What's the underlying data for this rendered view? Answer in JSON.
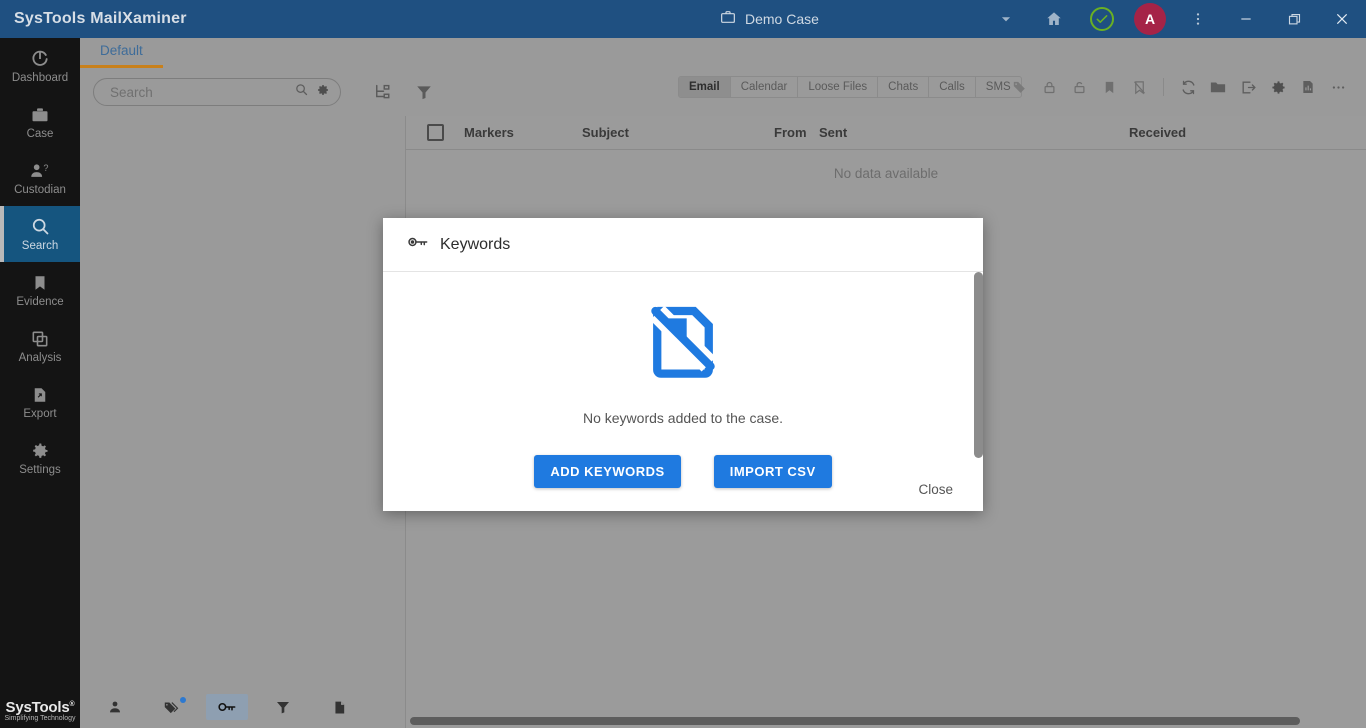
{
  "titlebar": {
    "app_title": "SysTools MailXaminer",
    "case_icon": "briefcase-icon",
    "case_name": "Demo Case",
    "dropdown_icon": "chevron-down-icon",
    "home_icon": "home-icon",
    "status_icon": "check-circle-icon",
    "avatar_letter": "A",
    "more_icon": "more-vertical-icon",
    "minimize_icon": "minimize-icon",
    "restore_icon": "restore-icon",
    "close_icon": "close-icon",
    "bg_color": "#1f5081",
    "avatar_color": "#a52347",
    "status_color": "#6ab023"
  },
  "sidebar": {
    "items": [
      {
        "label": "Dashboard",
        "icon": "dashboard-icon",
        "active": false
      },
      {
        "label": "Case",
        "icon": "briefcase-icon",
        "active": false
      },
      {
        "label": "Custodian",
        "icon": "custodian-icon",
        "active": false
      },
      {
        "label": "Search",
        "icon": "search-icon",
        "active": true
      },
      {
        "label": "Evidence",
        "icon": "evidence-icon",
        "active": false
      },
      {
        "label": "Analysis",
        "icon": "analysis-icon",
        "active": false
      },
      {
        "label": "Export",
        "icon": "export-icon",
        "active": false
      },
      {
        "label": "Settings",
        "icon": "gear-icon",
        "active": false
      }
    ],
    "active_color": "#15557f",
    "logo_name": "SysTools",
    "logo_reg": "®",
    "logo_tagline": "Simplifying Technology"
  },
  "tabs": {
    "document_tab": "Default",
    "underline_color": "#c8801b"
  },
  "toolbar": {
    "search_placeholder": "Search",
    "search_value": "",
    "search_icon": "search-icon",
    "search_settings_icon": "gear-icon",
    "tree_icon": "tree-view-icon",
    "filter_icon": "filter-icon",
    "type_tabs": [
      {
        "label": "Email",
        "selected": true
      },
      {
        "label": "Calendar",
        "selected": false
      },
      {
        "label": "Loose Files",
        "selected": false
      },
      {
        "label": "Chats",
        "selected": false
      },
      {
        "label": "Calls",
        "selected": false
      },
      {
        "label": "SMS",
        "selected": false
      }
    ],
    "action_icons": [
      "tag-add-icon",
      "lock-icon",
      "unlock-icon",
      "bookmark-icon",
      "bookmark-off-icon",
      "refresh-icon",
      "folder-open-icon",
      "export-arrow-icon",
      "gear-icon",
      "report-icon",
      "more-horizontal-icon"
    ]
  },
  "grid": {
    "check_all_icon": "checkbox-icon",
    "columns": [
      "Markers",
      "Subject",
      "From",
      "Sent",
      "Received"
    ],
    "rows": [],
    "empty_message": "No data available",
    "scrollbar": "horizontal-scrollbar"
  },
  "bottom_tools": {
    "items": [
      {
        "icon": "person-icon",
        "selected": false,
        "badge": false
      },
      {
        "icon": "tags-icon",
        "selected": false,
        "badge": true
      },
      {
        "icon": "key-icon",
        "selected": true,
        "badge": false
      },
      {
        "icon": "filter-icon",
        "selected": false,
        "badge": false
      },
      {
        "icon": "document-icon",
        "selected": false,
        "badge": false
      }
    ],
    "badge_color": "#2d79d0"
  },
  "modal": {
    "icon": "key-icon",
    "title": "Keywords",
    "art_icon": "no-keywords-icon",
    "art_color": "#1f7ae0",
    "empty_text": "No keywords added to the case.",
    "primary_button": "ADD KEYWORDS",
    "secondary_button": "IMPORT CSV",
    "button_color": "#1f7ae0",
    "close_label": "Close",
    "scrollbar": "vertical-scrollbar"
  }
}
